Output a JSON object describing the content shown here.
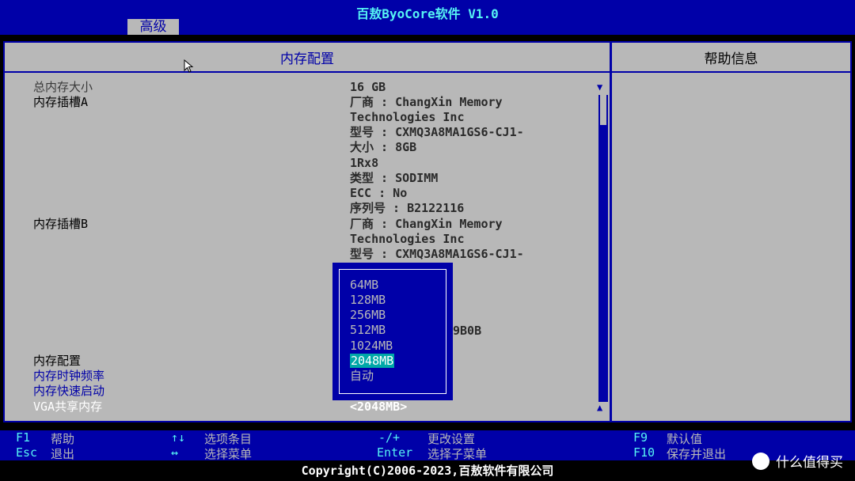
{
  "window": {
    "title": "百敖ByoCore软件 V1.0",
    "active_tab": "高级"
  },
  "panel": {
    "left_header": "内存配置",
    "right_header": "帮助信息"
  },
  "rows": [
    {
      "label": "总内存大小",
      "value": "16 GB"
    },
    {
      "label": "内存插槽A",
      "value": "厂商 : ChangXin Memory"
    },
    {
      "label": "",
      "value": "Technologies Inc"
    },
    {
      "label": "",
      "value": "型号 : CXMQ3A8MA1GS6-CJ1-"
    },
    {
      "label": "",
      "value": "大小 : 8GB"
    },
    {
      "label": "",
      "value": "1Rx8"
    },
    {
      "label": "",
      "value": "类型 : SODIMM"
    },
    {
      "label": "",
      "value": "ECC : No"
    },
    {
      "label": "",
      "value": "序列号 : B2122116"
    },
    {
      "label": "内存插槽B",
      "value": "厂商 : ChangXin Memory"
    },
    {
      "label": "",
      "value": "Technologies Inc"
    },
    {
      "label": "",
      "value": "型号 : CXMQ3A8MA1GS6-CJ1-"
    }
  ],
  "partial_hidden_value": "9B0B",
  "settings": [
    {
      "label": "内存配置"
    },
    {
      "label": "内存时钟频率"
    },
    {
      "label": "内存快速启动"
    },
    {
      "label": "VGA共享内存",
      "value": "<2048MB>"
    }
  ],
  "popup": {
    "options": [
      "64MB",
      "128MB",
      "256MB",
      "512MB",
      "1024MB",
      "2048MB",
      "自动"
    ],
    "selected": "2048MB"
  },
  "footer": {
    "items": [
      {
        "key": "F1",
        "desc": "帮助"
      },
      {
        "key": "Esc",
        "desc": "退出"
      },
      {
        "key": "↑↓",
        "desc": "选项条目"
      },
      {
        "key": "↔",
        "desc": "选择菜单"
      },
      {
        "key": "-/+",
        "desc": "更改设置"
      },
      {
        "key": "Enter",
        "desc": "选择子菜单"
      },
      {
        "key": "F9",
        "desc": "默认值"
      },
      {
        "key": "F10",
        "desc": "保存并退出"
      }
    ],
    "copyright": "Copyright(C)2006-2023,百敖软件有限公司"
  },
  "watermark": "什么值得买",
  "colors": {
    "bios_blue": "#0000a8",
    "panel_gray": "#b8b8b8",
    "cyan": "#56f3f3",
    "highlight": "#00a8a8"
  }
}
